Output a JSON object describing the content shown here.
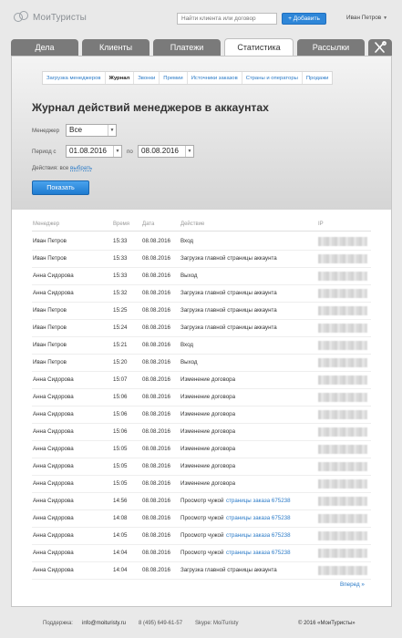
{
  "app": {
    "logo_text": "МоиТуристы",
    "search_placeholder": "Найти клиента или договор",
    "add_button": "+ Добавить",
    "user_name": "Иван Петров",
    "user_caret": "▼"
  },
  "main_tabs": [
    {
      "label": "Дела",
      "active": false
    },
    {
      "label": "Клиенты",
      "active": false
    },
    {
      "label": "Платежи",
      "active": false
    },
    {
      "label": "Статистика",
      "active": true
    },
    {
      "label": "Рассылки",
      "active": false
    }
  ],
  "tools_icon": "wrench-screwdriver-icon",
  "sub_tabs": [
    {
      "label": "Загрузка менеджеров",
      "active": false
    },
    {
      "label": "Журнал",
      "active": true
    },
    {
      "label": "Звонки",
      "active": false
    },
    {
      "label": "Премии",
      "active": false
    },
    {
      "label": "Источники заказов",
      "active": false
    },
    {
      "label": "Страны и операторы",
      "active": false
    },
    {
      "label": "Продажи",
      "active": false
    }
  ],
  "page_title": "Журнал действий менеджеров в аккаунтах",
  "filters": {
    "manager_label": "Менеджер",
    "manager_value": "Все",
    "period_from_label": "Период с",
    "period_from": "01.08.2016",
    "period_to_label": "по",
    "period_to": "08.08.2016",
    "actions_label": "Действия: все",
    "actions_link": "выбрать",
    "show_button": "Показать",
    "dropdown_glyph": "▼"
  },
  "table": {
    "columns": [
      "Менеджер",
      "Время",
      "Дата",
      "Действие",
      "IP"
    ],
    "rows": [
      {
        "manager": "Иван Петров",
        "time": "15:33",
        "date": "08.08.2016",
        "action": "Вход",
        "link": ""
      },
      {
        "manager": "Иван Петров",
        "time": "15:33",
        "date": "08.08.2016",
        "action": "Загрузка главной страницы аккаунта",
        "link": ""
      },
      {
        "manager": "Анна Сидорова",
        "time": "15:33",
        "date": "08.08.2016",
        "action": "Выход",
        "link": ""
      },
      {
        "manager": "Анна Сидорова",
        "time": "15:32",
        "date": "08.08.2016",
        "action": "Загрузка главной страницы аккаунта",
        "link": ""
      },
      {
        "manager": "Иван Петров",
        "time": "15:25",
        "date": "08.08.2016",
        "action": "Загрузка главной страницы аккаунта",
        "link": ""
      },
      {
        "manager": "Иван Петров",
        "time": "15:24",
        "date": "08.08.2016",
        "action": "Загрузка главной страницы аккаунта",
        "link": ""
      },
      {
        "manager": "Иван Петров",
        "time": "15:21",
        "date": "08.08.2016",
        "action": "Вход",
        "link": ""
      },
      {
        "manager": "Иван Петров",
        "time": "15:20",
        "date": "08.08.2016",
        "action": "Выход",
        "link": ""
      },
      {
        "manager": "Анна Сидорова",
        "time": "15:07",
        "date": "08.08.2016",
        "action": "Изменение договора",
        "link": ""
      },
      {
        "manager": "Анна Сидорова",
        "time": "15:06",
        "date": "08.08.2016",
        "action": "Изменение договора",
        "link": ""
      },
      {
        "manager": "Анна Сидорова",
        "time": "15:06",
        "date": "08.08.2016",
        "action": "Изменение договора",
        "link": ""
      },
      {
        "manager": "Анна Сидорова",
        "time": "15:06",
        "date": "08.08.2016",
        "action": "Изменение договора",
        "link": ""
      },
      {
        "manager": "Анна Сидорова",
        "time": "15:05",
        "date": "08.08.2016",
        "action": "Изменение договора",
        "link": ""
      },
      {
        "manager": "Анна Сидорова",
        "time": "15:05",
        "date": "08.08.2016",
        "action": "Изменение договора",
        "link": ""
      },
      {
        "manager": "Анна Сидорова",
        "time": "15:05",
        "date": "08.08.2016",
        "action": "Изменение договора",
        "link": ""
      },
      {
        "manager": "Анна Сидорова",
        "time": "14:56",
        "date": "08.08.2016",
        "action": "Просмотр чужой",
        "link": "страницы заказа 675238"
      },
      {
        "manager": "Анна Сидорова",
        "time": "14:08",
        "date": "08.08.2016",
        "action": "Просмотр чужой",
        "link": "страницы заказа 675238"
      },
      {
        "manager": "Анна Сидорова",
        "time": "14:05",
        "date": "08.08.2016",
        "action": "Просмотр чужой",
        "link": "страницы заказа 675238"
      },
      {
        "manager": "Анна Сидорова",
        "time": "14:04",
        "date": "08.08.2016",
        "action": "Просмотр чужой",
        "link": "страницы заказа 675238"
      },
      {
        "manager": "Анна Сидорова",
        "time": "14:04",
        "date": "08.08.2016",
        "action": "Загрузка главной страницы аккаунта",
        "link": ""
      }
    ],
    "next_link": "Вперед »"
  },
  "footer": {
    "support_label": "Поддержка:",
    "email": "info@moituristy.ru",
    "phone": "8 (495) 649-61-57",
    "skype": "Skype: MoiTuristy",
    "copyright": "© 2016 «МоиТуристы»"
  },
  "colors": {
    "accent": "#2e86d8",
    "link": "#2a7ac7",
    "tab_inactive": "#7a7a7a"
  }
}
